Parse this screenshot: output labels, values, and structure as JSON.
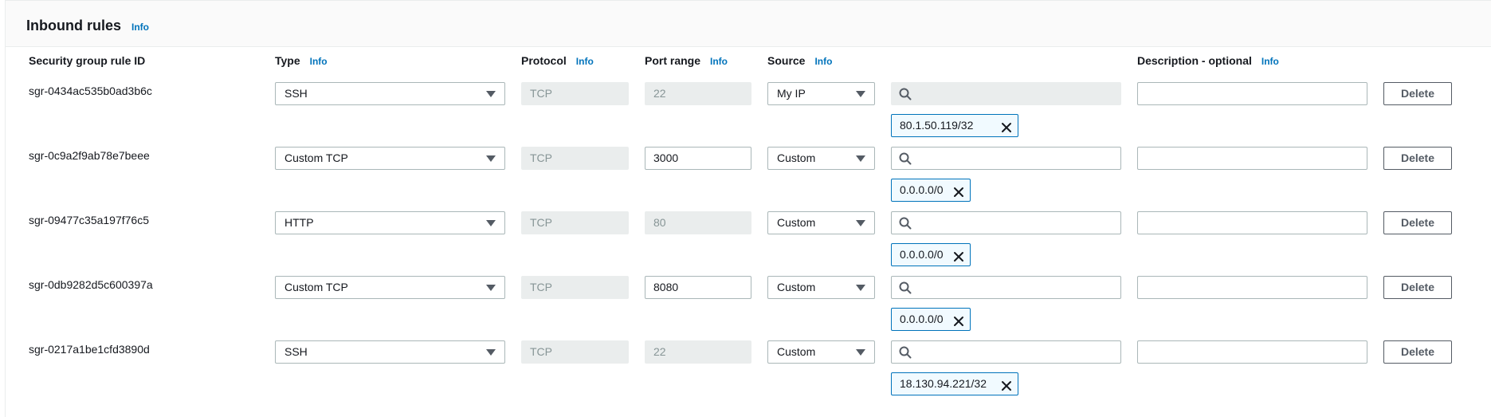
{
  "panel": {
    "title": "Inbound rules",
    "info_label": "Info"
  },
  "columns": {
    "rule_id": "Security group rule ID",
    "type": "Type",
    "protocol": "Protocol",
    "port_range": "Port range",
    "source": "Source",
    "description": "Description - optional",
    "info_label": "Info"
  },
  "rows": [
    {
      "id": "sgr-0434ac535b0ad3b6c",
      "type": "SSH",
      "protocol": "TCP",
      "port": "22",
      "port_editable": false,
      "source": "My IP",
      "search_disabled": true,
      "token": "80.1.50.119/32",
      "description": "",
      "delete_label": "Delete"
    },
    {
      "id": "sgr-0c9a2f9ab78e7beee",
      "type": "Custom TCP",
      "protocol": "TCP",
      "port": "3000",
      "port_editable": true,
      "source": "Custom",
      "search_disabled": false,
      "token": "0.0.0.0/0",
      "description": "",
      "delete_label": "Delete"
    },
    {
      "id": "sgr-09477c35a197f76c5",
      "type": "HTTP",
      "protocol": "TCP",
      "port": "80",
      "port_editable": false,
      "source": "Custom",
      "search_disabled": false,
      "token": "0.0.0.0/0",
      "description": "",
      "delete_label": "Delete"
    },
    {
      "id": "sgr-0db9282d5c600397a",
      "type": "Custom TCP",
      "protocol": "TCP",
      "port": "8080",
      "port_editable": true,
      "source": "Custom",
      "search_disabled": false,
      "token": "0.0.0.0/0",
      "description": "",
      "delete_label": "Delete"
    },
    {
      "id": "sgr-0217a1be1cfd3890d",
      "type": "SSH",
      "protocol": "TCP",
      "port": "22",
      "port_editable": false,
      "source": "Custom",
      "search_disabled": false,
      "token": "18.130.94.221/32",
      "description": "",
      "delete_label": "Delete"
    }
  ],
  "colors": {
    "accent": "#0073bb",
    "token_bg": "#f1faff",
    "disabled_bg": "#eaeded"
  },
  "icons": {
    "search": "search-icon",
    "dropdown": "caret-down-icon",
    "remove": "close-icon"
  }
}
